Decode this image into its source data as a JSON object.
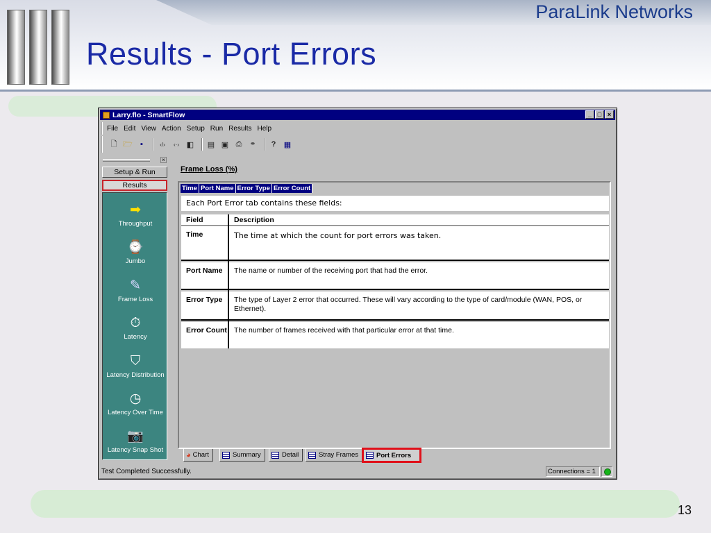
{
  "slide": {
    "title": "Results - Port Errors",
    "brand": "ParaLink Networks",
    "page_number": "13"
  },
  "window": {
    "title": "Larry.flo - SmartFlow",
    "menu": [
      "File",
      "Edit",
      "View",
      "Action",
      "Setup",
      "Run",
      "Results",
      "Help"
    ]
  },
  "sidebar": {
    "setup_run_label": "Setup & Run",
    "results_label": "Results",
    "items": [
      {
        "label": "Throughput",
        "icon": "arrow-icon"
      },
      {
        "label": "Jumbo",
        "icon": "jumbo-icon"
      },
      {
        "label": "Frame Loss",
        "icon": "frame-loss-icon"
      },
      {
        "label": "Latency",
        "icon": "stopwatch-icon"
      },
      {
        "label": "Latency Distribution",
        "icon": "bucket-icon"
      },
      {
        "label": "Latency Over Time",
        "icon": "clock-icon"
      },
      {
        "label": "Latency Snap Shot",
        "icon": "camera-icon"
      }
    ]
  },
  "content": {
    "section_title": "Frame Loss (%)",
    "columns": [
      "Time",
      "Port Name",
      "Error Type",
      "Error Count"
    ],
    "intro": "Each Port Error tab contains these fields:",
    "table_headers": {
      "field": "Field",
      "description": "Description"
    },
    "rows": [
      {
        "field": "Time",
        "description": "The time at which the count for port errors was taken."
      },
      {
        "field": "Port Name",
        "description": "The name or number of the receiving port that had the error."
      },
      {
        "field": "Error Type",
        "description": "The type of Layer 2 error that occurred. These will vary according to the type of card/module (WAN, POS, or Ethernet)."
      },
      {
        "field": "Error Count",
        "description": "The number of frames received with that particular  error at that time."
      }
    ]
  },
  "tabs": [
    "Chart",
    "Summary",
    "Detail",
    "Stray Frames",
    "Port Errors"
  ],
  "status": {
    "message": "Test Completed Successfully.",
    "connections": "Connections = 1"
  },
  "colors": {
    "title_blue": "#1a2aa6",
    "titlebar": "#000080",
    "sidebar_panel": "#3c8580",
    "highlight_red": "#e0101a"
  }
}
